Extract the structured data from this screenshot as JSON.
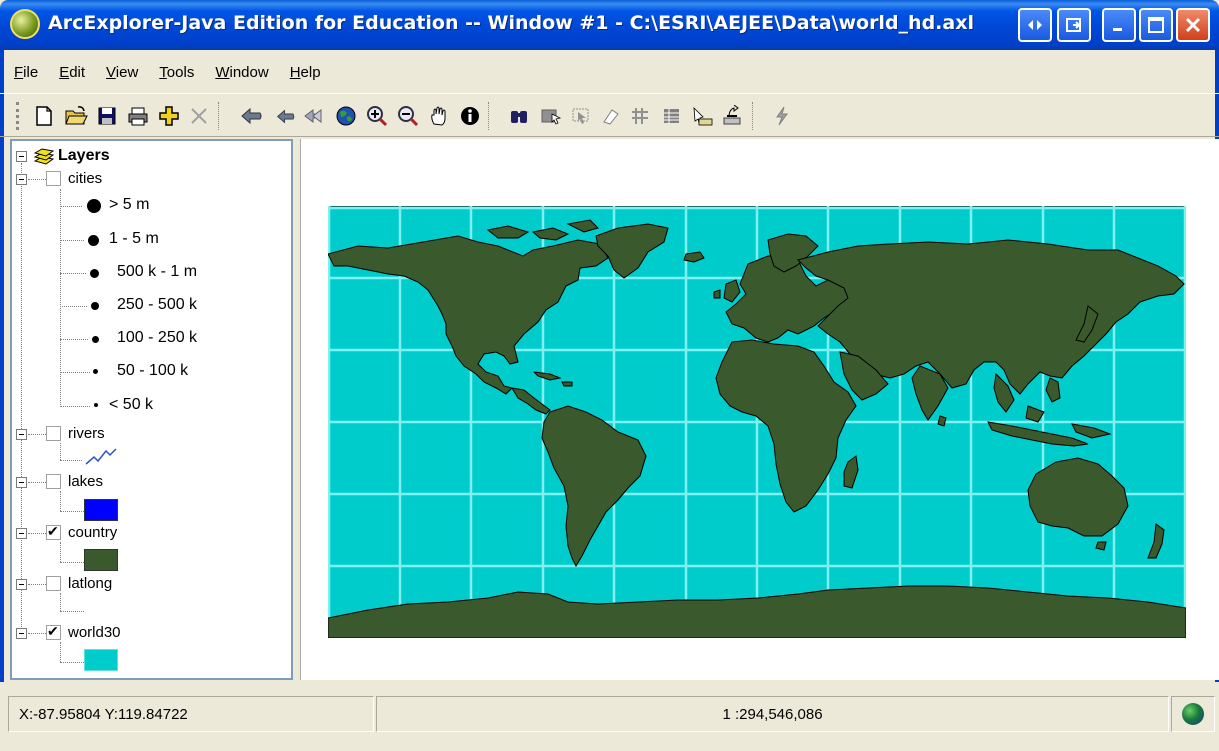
{
  "window": {
    "title": "ArcExplorer-Java Edition for Education -- Window #1 - C:\\ESRI\\AEJEE\\Data\\world_hd.axl"
  },
  "menu": {
    "items": [
      {
        "label": "File",
        "accel": "F",
        "rest": "ile"
      },
      {
        "label": "Edit",
        "accel": "E",
        "rest": "dit"
      },
      {
        "label": "View",
        "accel": "V",
        "rest": "iew"
      },
      {
        "label": "Tools",
        "accel": "T",
        "rest": "ools"
      },
      {
        "label": "Window",
        "accel": "W",
        "rest": "indow"
      },
      {
        "label": "Help",
        "accel": "H",
        "rest": "elp"
      }
    ]
  },
  "toolbar": {
    "tools": [
      "new-icon",
      "open-icon",
      "save-icon",
      "print-icon",
      "add-layer-icon",
      "delete-icon",
      "back-icon",
      "forward-icon",
      "full-extent-icon",
      "globe-icon",
      "zoom-in-icon",
      "zoom-out-icon",
      "pan-icon",
      "identify-icon",
      "find-icon",
      "select-icon",
      "select-box-icon",
      "clear-select-icon",
      "measure-icon",
      "attributes-icon",
      "label-icon",
      "query-icon",
      "hotlink-icon"
    ]
  },
  "layers": {
    "root_label": "Layers",
    "items": [
      {
        "name": "cities",
        "checked": false
      },
      {
        "name": "rivers",
        "checked": false
      },
      {
        "name": "lakes",
        "checked": false
      },
      {
        "name": "country",
        "checked": true
      },
      {
        "name": "latlong",
        "checked": false
      },
      {
        "name": "world30",
        "checked": true
      }
    ],
    "cities_legend": [
      "> 5 m",
      "1 - 5 m",
      "500 k - 1 m",
      "250 - 500 k",
      "100 - 250 k",
      "50 - 100 k",
      "< 50 k"
    ],
    "colors": {
      "lakes": "#0000ff",
      "country": "#3a5a2e",
      "world30": "#00cccc",
      "rivers": "#3050d0"
    }
  },
  "map": {
    "ocean_color": "#00cccc",
    "land_color": "#3a5a2e",
    "grid_color": "#7ff0f0"
  },
  "status": {
    "coords": "X:-87.95804 Y:119.84722",
    "scale": "1 :294,546,086"
  }
}
